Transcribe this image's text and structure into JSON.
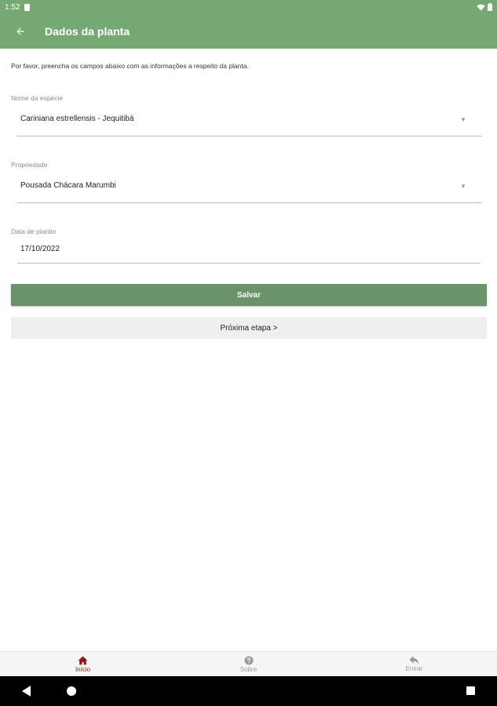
{
  "status_bar": {
    "time": "1:52",
    "icons": [
      "sim-card-icon",
      "wifi-icon",
      "battery-icon"
    ]
  },
  "app_bar": {
    "title": "Dados da planta",
    "back_icon": "arrow-back-icon"
  },
  "instructions": "Por favor, preencha os campos abaixo com as informações a respeito da planta.",
  "form": {
    "species": {
      "label": "Nome da espécie",
      "value": "Cariniana estrellensis - Jequitibá"
    },
    "property": {
      "label": "Propriedade",
      "value": "Pousada Chácara Marumbi"
    },
    "planting_date": {
      "label": "Data de plantio",
      "value": "17/10/2022"
    }
  },
  "buttons": {
    "save": "Salvar",
    "next": "Próxima etapa >"
  },
  "bottom_nav": [
    {
      "label": "Início",
      "icon": "home-icon",
      "active": true
    },
    {
      "label": "Sobre",
      "icon": "help-icon",
      "active": false
    },
    {
      "label": "Entrar",
      "icon": "reply-icon",
      "active": false
    }
  ],
  "colors": {
    "app_bar": "#76a874",
    "save_button": "#6b9369",
    "nav_active": "#8b1c1c",
    "nav_inactive": "#9a9a9a"
  }
}
